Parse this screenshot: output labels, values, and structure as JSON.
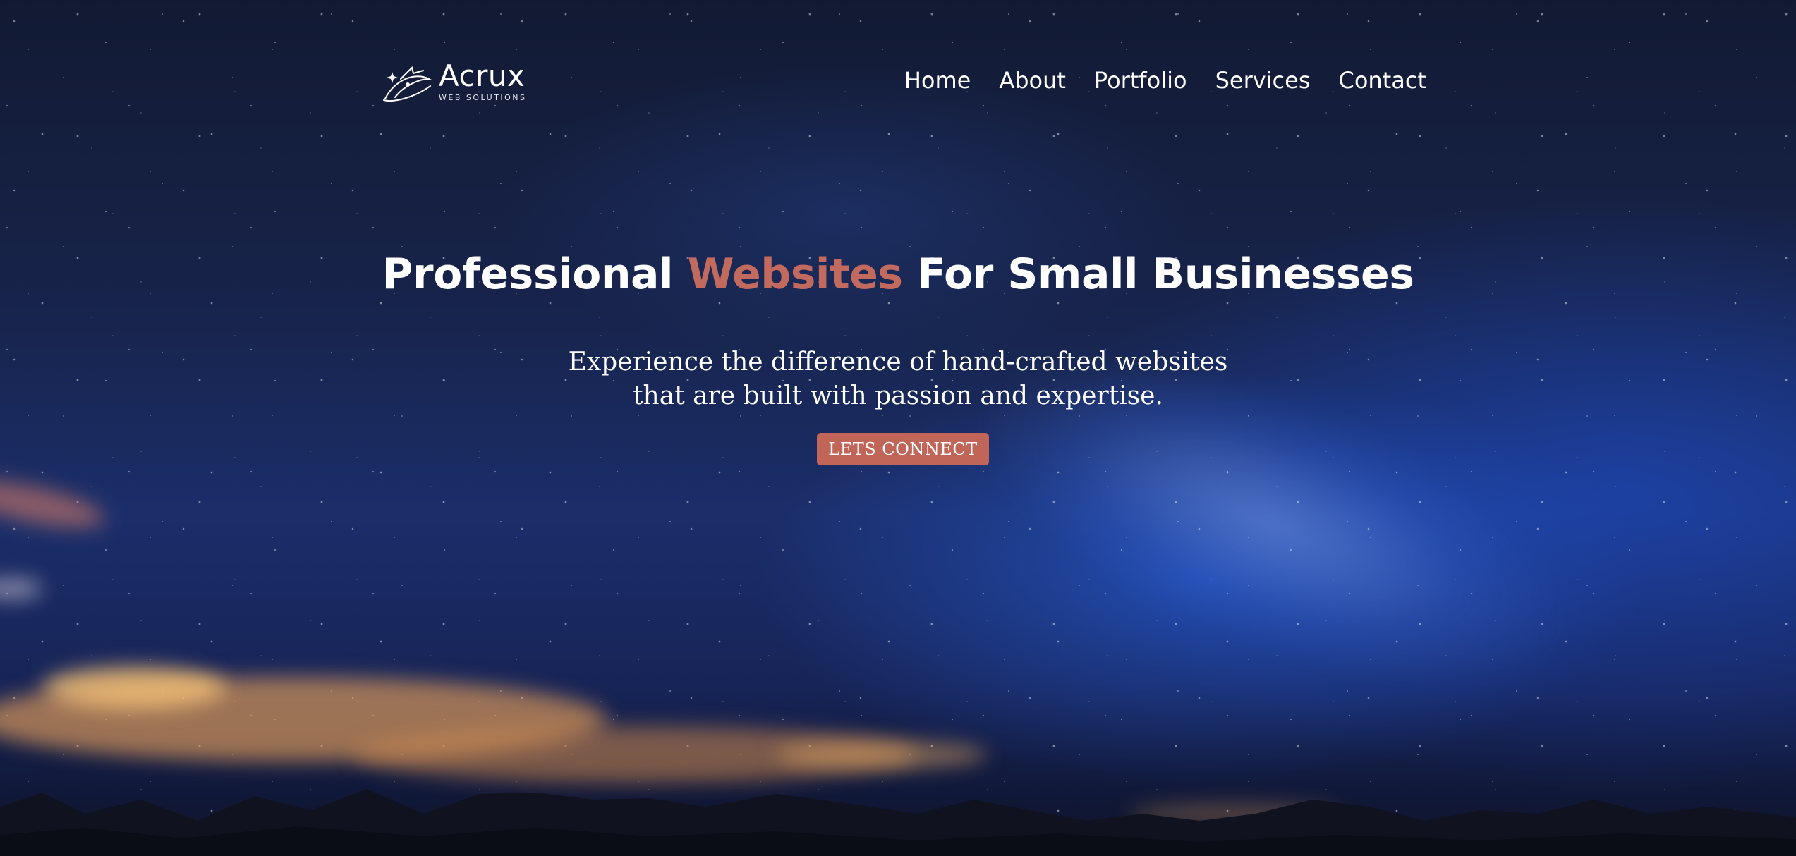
{
  "brand": {
    "name": "Acrux",
    "tagline": "WEB SOLUTIONS",
    "logo_icon": "star-orbit-icon"
  },
  "nav": {
    "items": [
      {
        "label": "Home"
      },
      {
        "label": "About"
      },
      {
        "label": "Portfolio"
      },
      {
        "label": "Services"
      },
      {
        "label": "Contact"
      }
    ]
  },
  "hero": {
    "headline_prefix": "Professional",
    "headline_accent": "Websites",
    "headline_suffix": "For Small Businesses",
    "subtext_line1": "Experience the difference of hand-crafted websites",
    "subtext_line2": "that are built with passion and expertise.",
    "cta_label": "LETS CONNECT"
  },
  "colors": {
    "accent": "#c36a5e",
    "text": "#ffffff"
  }
}
